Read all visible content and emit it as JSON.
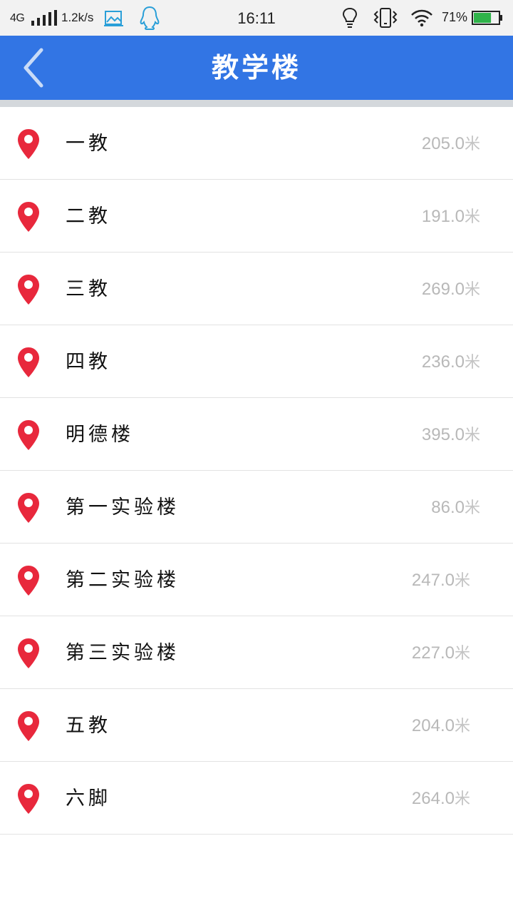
{
  "status_bar": {
    "network": "4G",
    "speed": "1.2k/s",
    "time": "16:11",
    "battery_percent": "71%",
    "battery_level": 0.71,
    "icons": [
      "signal-icon",
      "image-icon",
      "qq-icon",
      "bulb-icon",
      "vibrate-icon",
      "wifi-icon",
      "battery-icon"
    ]
  },
  "header": {
    "title": "教学楼",
    "back_icon": "chevron-left-icon",
    "background": "#3275e4"
  },
  "unit": "米",
  "pin_color": "#e8283c",
  "buildings": [
    {
      "name": "一教",
      "distance": "205.0"
    },
    {
      "name": "二教",
      "distance": "191.0"
    },
    {
      "name": "三教",
      "distance": "269.0"
    },
    {
      "name": "四教",
      "distance": "236.0"
    },
    {
      "name": "明德楼",
      "distance": "395.0"
    },
    {
      "name": "第一实验楼",
      "distance": "86.0"
    },
    {
      "name": "第二实验楼",
      "distance": "247.0"
    },
    {
      "name": "第三实验楼",
      "distance": "227.0"
    },
    {
      "name": "五教",
      "distance": "204.0"
    },
    {
      "name": "六脚",
      "distance": "264.0"
    }
  ]
}
